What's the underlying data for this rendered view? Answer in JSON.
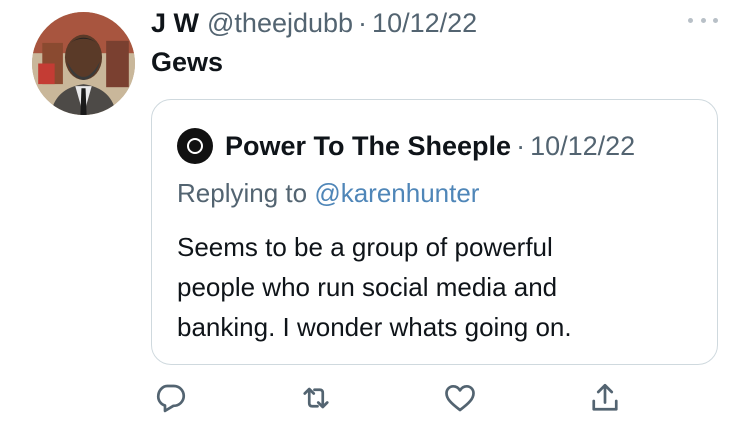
{
  "tweet": {
    "name": "J W",
    "handle": "@theejdubb",
    "separator": "·",
    "date": "10/12/22",
    "text": "Gews"
  },
  "quoted_tweet": {
    "name": "Power To The Sheeple",
    "separator": "·",
    "date": "10/12/22",
    "replying_prefix": "Replying to",
    "replying_to": "@karenhunter",
    "text_lines": [
      "Seems to be a group of powerful",
      "people who run social media and",
      "banking. I wonder whats going on."
    ]
  },
  "icons": {
    "more": "more-horizontal-icon",
    "reply": "reply-icon",
    "retweet": "retweet-icon",
    "like": "heart-icon",
    "share": "share-icon"
  },
  "colors": {
    "secondary_text": "#536471",
    "mention": "#4f86b8",
    "border": "#cfd9de"
  }
}
